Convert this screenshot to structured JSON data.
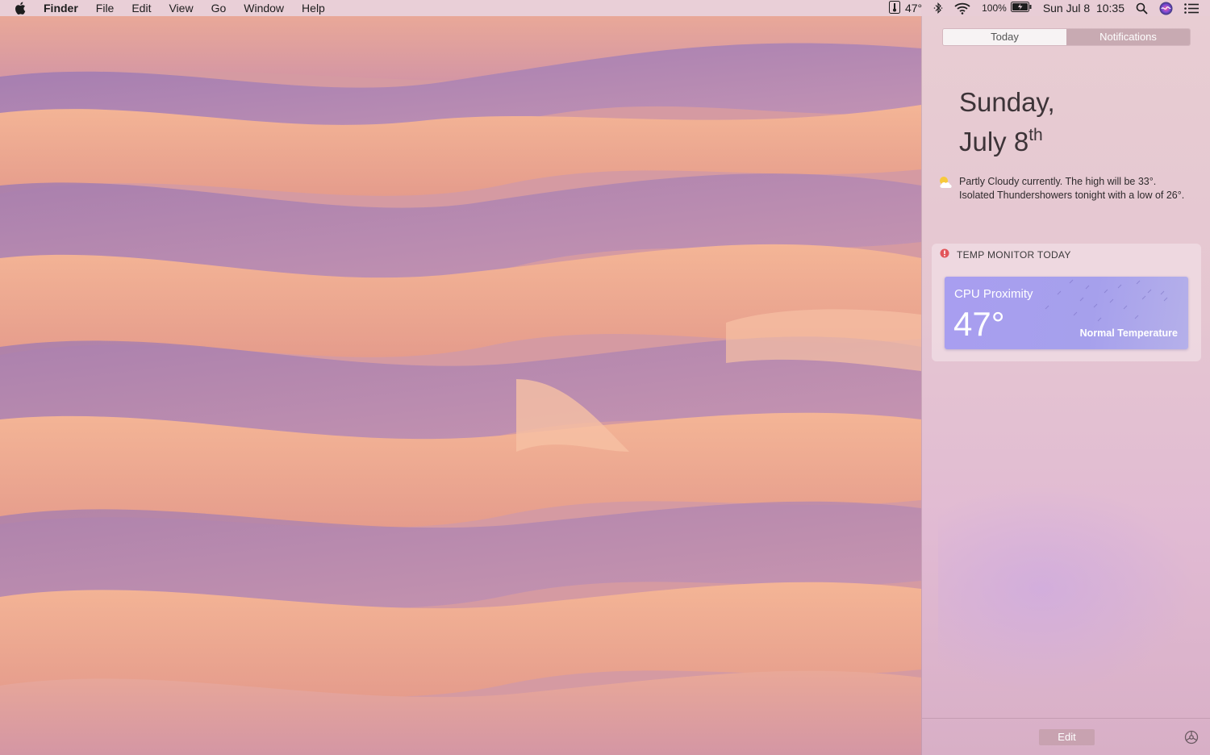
{
  "menubar": {
    "apple_icon": "apple-logo-icon",
    "app_name": "Finder",
    "menus": [
      "File",
      "Edit",
      "View",
      "Go",
      "Window",
      "Help"
    ],
    "status": {
      "temp": "47°",
      "battery_percent": "100%",
      "datetime": "Sun Jul 8  10:35"
    },
    "icons": [
      "temp-monitor-icon",
      "bluetooth-icon",
      "wifi-icon",
      "battery-icon",
      "spotlight-search-icon",
      "siri-icon",
      "notification-center-icon"
    ]
  },
  "notification_center": {
    "tabs": [
      {
        "label": "Today",
        "active": true
      },
      {
        "label": "Notifications",
        "active": false
      }
    ],
    "date_line1": "Sunday,",
    "date_line2": "July 8",
    "date_suffix": "th",
    "weather_text": "Partly Cloudy currently. The high will be 33°. Isolated Thundershowers tonight with a low of 26°.",
    "widget": {
      "title": "TEMP MONITOR TODAY",
      "card_title": "CPU Proximity",
      "temperature": "47°",
      "status": "Normal Temperature",
      "card_color": "#a89ef0"
    },
    "edit_label": "Edit"
  }
}
